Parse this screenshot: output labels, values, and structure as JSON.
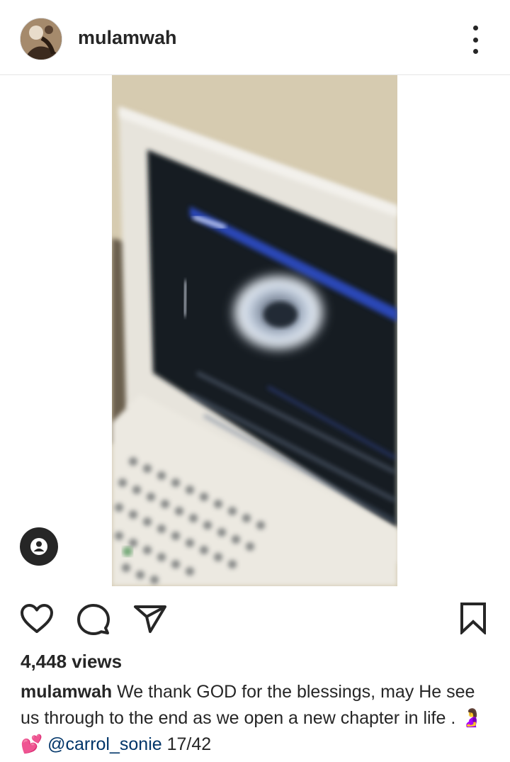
{
  "post": {
    "username": "mulamwah",
    "views": "4,448 views",
    "caption": {
      "username": "mulamwah",
      "text_before_emoji": " We thank GOD for the blessings, may He see us through to the end as we open a new chapter in life . ",
      "emojis": "🤰💕",
      "mention": "@carrol_sonie",
      "trailing": " 17/42"
    }
  },
  "icons": {
    "more": "more-vertical-icon",
    "user_tags": "user-tag-icon",
    "like": "heart-icon",
    "comment": "comment-bubble-icon",
    "share": "paper-plane-icon",
    "save": "bookmark-icon"
  },
  "colors": {
    "text": "#262626",
    "mention": "#003569",
    "divider": "#e6e6e6"
  }
}
